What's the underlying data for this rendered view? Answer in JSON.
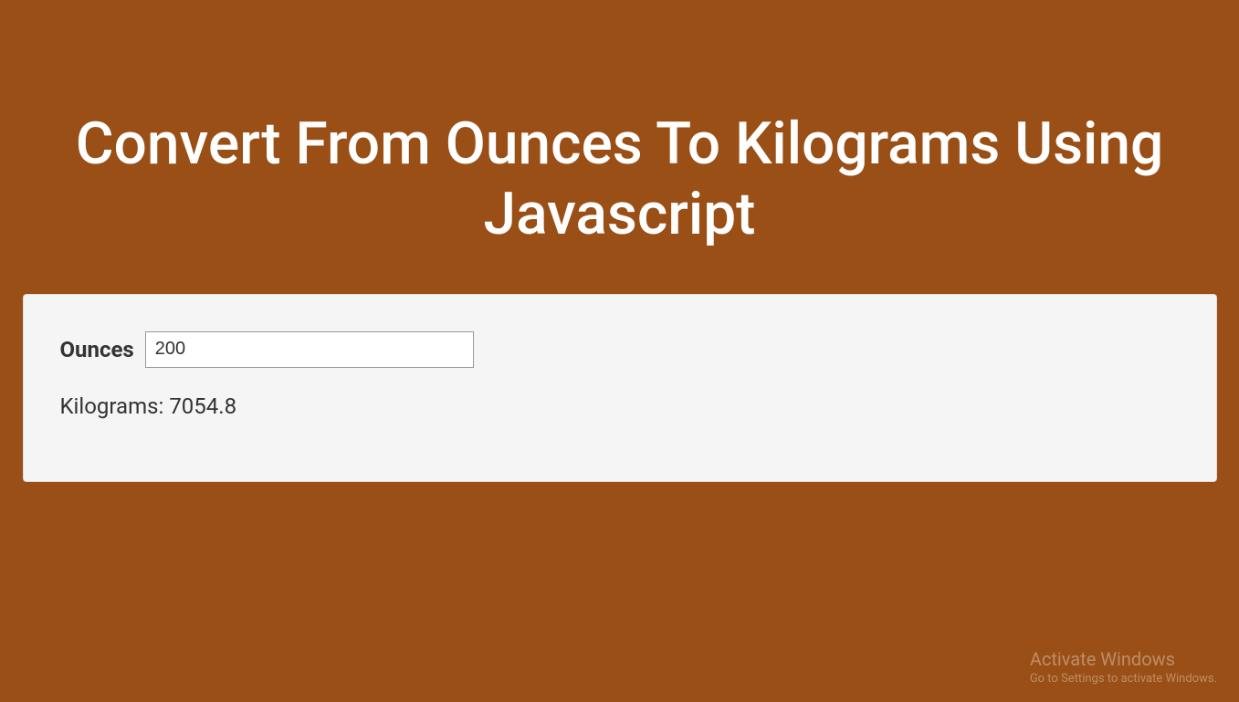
{
  "header": {
    "title": "Convert From Ounces To Kilograms Using Javascript"
  },
  "form": {
    "ounces_label": "Ounces",
    "ounces_value": "200",
    "result_label": "Kilograms:",
    "result_value": "7054.8"
  },
  "watermark": {
    "title": "Activate Windows",
    "subtitle": "Go to Settings to activate Windows."
  },
  "colors": {
    "background": "#9a4f16",
    "card_bg": "#f5f5f5",
    "text_light": "#ffffff",
    "text_dark": "#333333"
  }
}
